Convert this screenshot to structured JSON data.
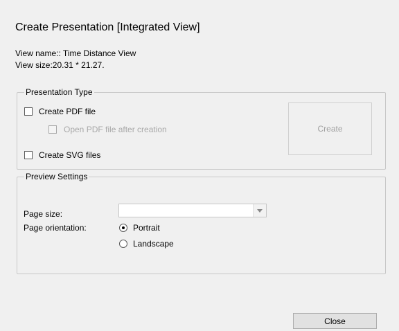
{
  "dialog": {
    "title": "Create Presentation [Integrated View]",
    "view_name": "View name:: Time Distance View",
    "view_size": "View size:20.31 * 21.27."
  },
  "presentation_type": {
    "legend": "Presentation Type",
    "create_pdf": {
      "label": "Create PDF file",
      "checked": false
    },
    "open_pdf": {
      "label": "Open PDF file after creation",
      "checked": false,
      "enabled": false
    },
    "create_svg": {
      "label": "Create SVG files",
      "checked": false
    },
    "create_button": {
      "label": "Create",
      "enabled": false
    }
  },
  "preview_settings": {
    "legend": "Preview Settings",
    "page_size_label": "Page size:",
    "page_size_value": "",
    "page_orientation_label": "Page orientation:",
    "orientations": [
      {
        "label": "Portrait",
        "checked": true
      },
      {
        "label": "Landscape",
        "checked": false
      }
    ]
  },
  "footer": {
    "close_label": "Close"
  }
}
